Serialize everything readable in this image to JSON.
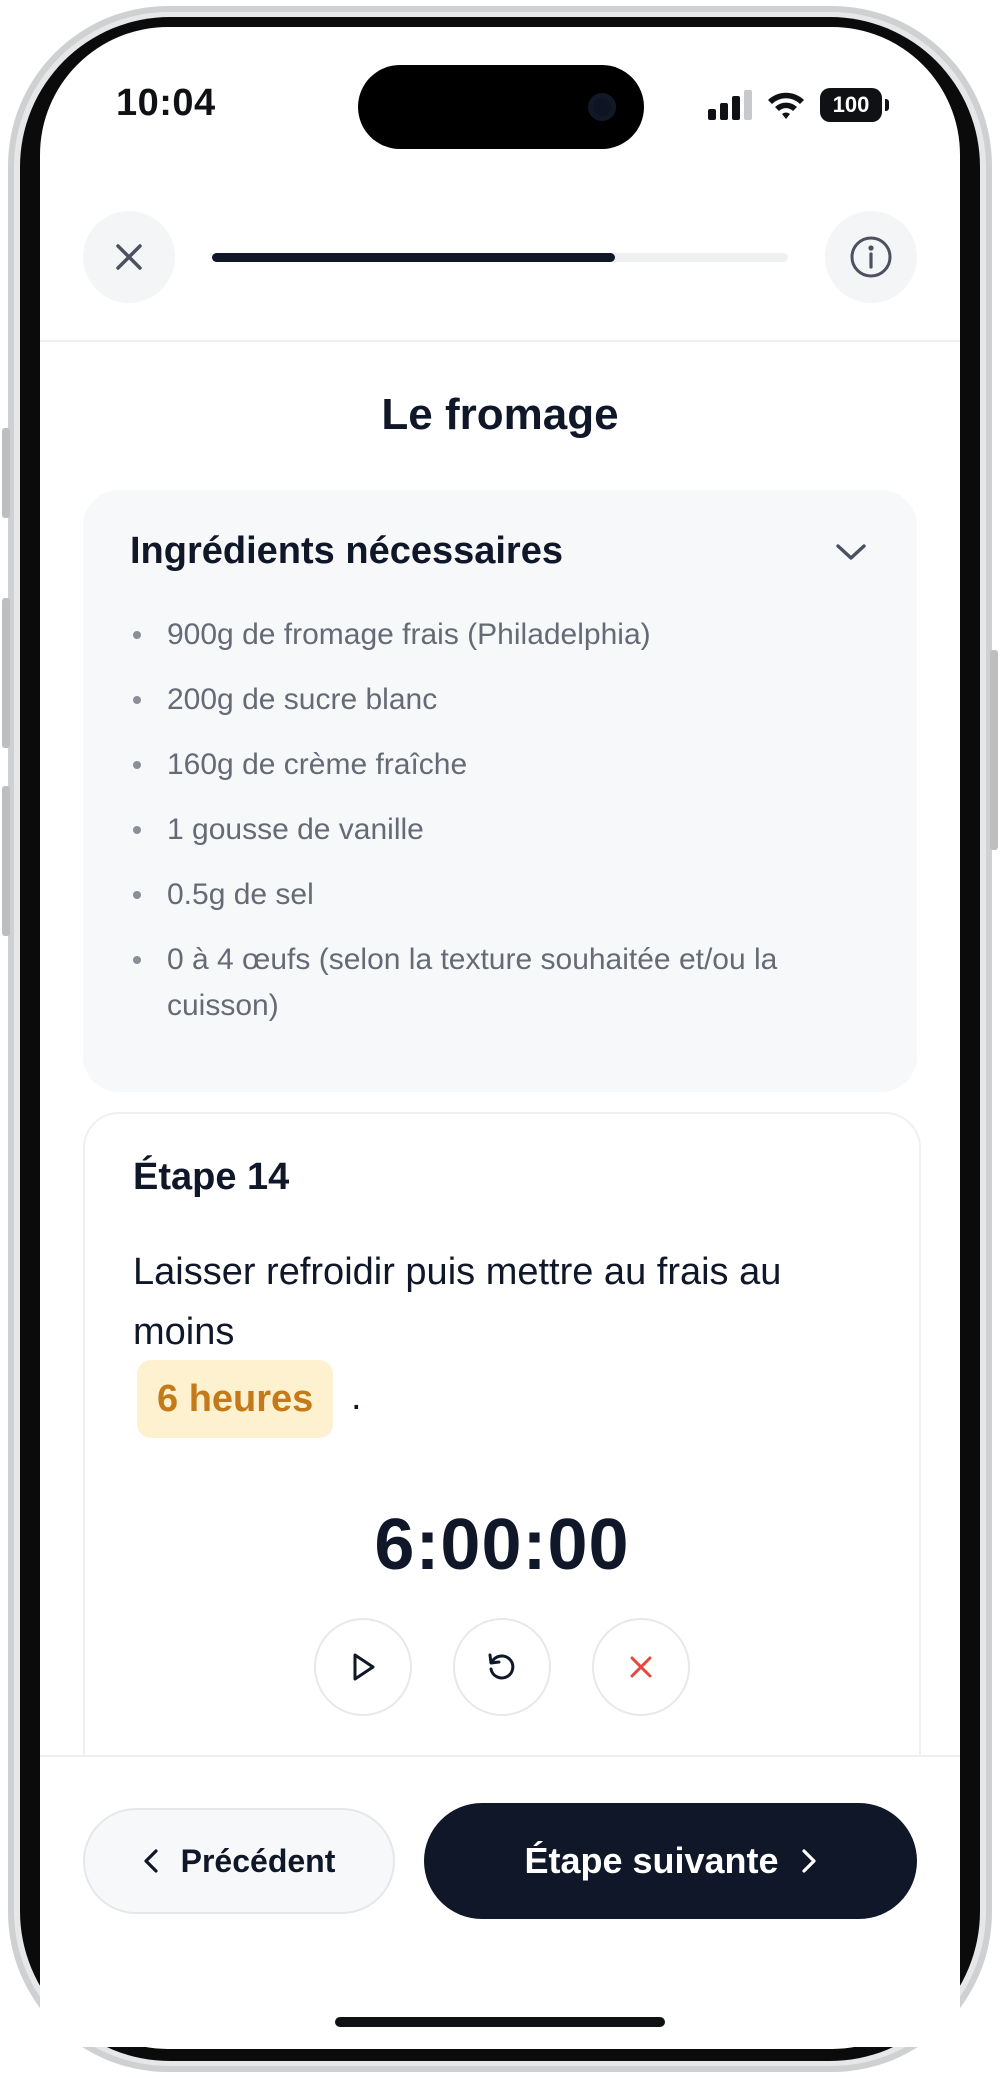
{
  "status_bar": {
    "time": "10:04",
    "battery": "100"
  },
  "header": {
    "close_icon": "close-icon",
    "info_icon": "info-icon",
    "progress": 0.7
  },
  "page": {
    "title": "Le fromage"
  },
  "ingredients": {
    "title": "Ingrédients nécessaires",
    "items": [
      "900g de fromage frais (Philadelphia)",
      "200g de sucre blanc",
      "160g de crème fraîche",
      "1 gousse de vanille",
      "0.5g de sel",
      "0 à 4 œufs (selon la texture souhaitée et/ou la cuisson)"
    ]
  },
  "step": {
    "title": "Étape 14",
    "text": "Laisser refroidir puis mettre au frais au moins",
    "duration_badge": "6 heures",
    "period": ".",
    "timer": "6:00:00"
  },
  "footer": {
    "prev_label": "Précédent",
    "next_label": "Étape suivante"
  },
  "colors": {
    "accent_dark": "#0f1729",
    "highlight_bg": "#fdf1cf",
    "highlight_text": "#c47a19",
    "cancel_red": "#e24a3b"
  }
}
